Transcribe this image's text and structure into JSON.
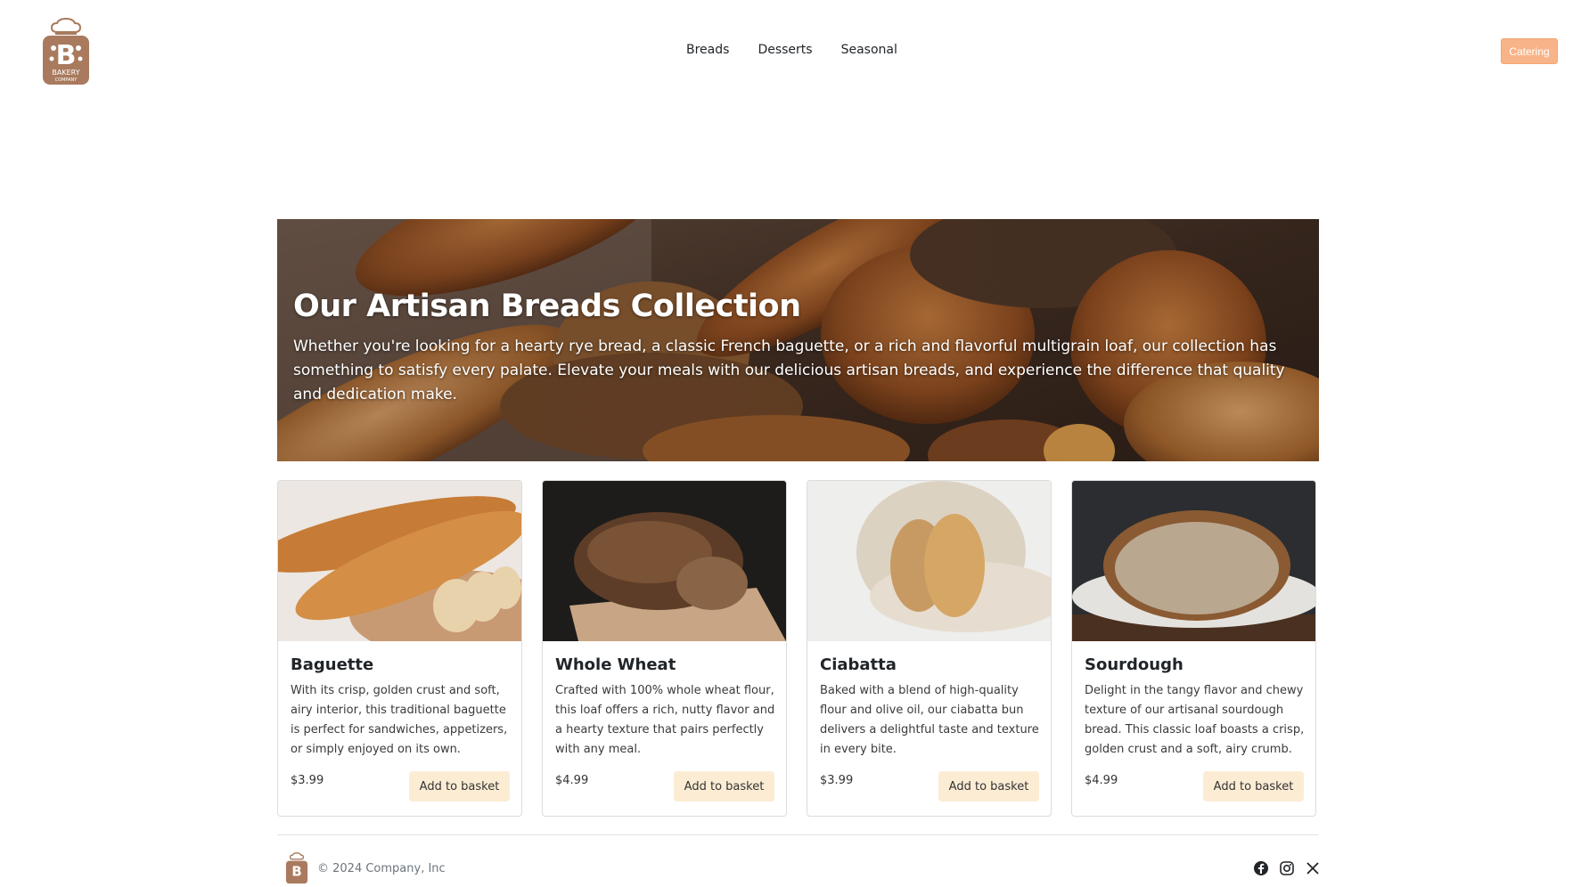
{
  "header": {
    "logo": {
      "word": "BAKERY",
      "sub": "COMPANY",
      "color": "#a97a5e"
    },
    "nav": [
      "Breads",
      "Desserts",
      "Seasonal"
    ],
    "cta_label": "Catering",
    "cta_color": "#f8b488"
  },
  "hero": {
    "title": "Our Artisan Breads Collection",
    "text": "Whether you're looking for a hearty rye bread, a classic French baguette, or a rich and flavorful multigrain loaf, our collection has something to satisfy every palate. Elevate your meals with our delicious artisan breads, and experience the difference that quality and dedication make."
  },
  "products": [
    {
      "name": "Baguette",
      "description": "With its crisp, golden crust and soft, airy interior, this traditional baguette is perfect for sandwiches, appetizers, or simply enjoyed on its own.",
      "price": "$3.99",
      "button": "Add to basket",
      "image": "baguette-photo"
    },
    {
      "name": "Whole Wheat",
      "description": "Crafted with 100% whole wheat flour, this loaf offers a rich, nutty flavor and a hearty texture that pairs perfectly with any meal.",
      "price": "$4.99",
      "button": "Add to basket",
      "image": "whole-wheat-photo"
    },
    {
      "name": "Ciabatta",
      "description": "Baked with a blend of high-quality flour and olive oil, our ciabatta bun delivers a delightful taste and texture in every bite.",
      "price": "$3.99",
      "button": "Add to basket",
      "image": "ciabatta-photo"
    },
    {
      "name": "Sourdough",
      "description": "Delight in the tangy flavor and chewy texture of our artisanal sourdough bread. This classic loaf boasts a crisp, golden crust and a soft, airy crumb.",
      "price": "$4.99",
      "button": "Add to basket",
      "image": "sourdough-photo"
    }
  ],
  "footer": {
    "copyright": "© 2024 Company, Inc",
    "social": [
      "facebook-icon",
      "instagram-icon",
      "x-icon"
    ]
  }
}
